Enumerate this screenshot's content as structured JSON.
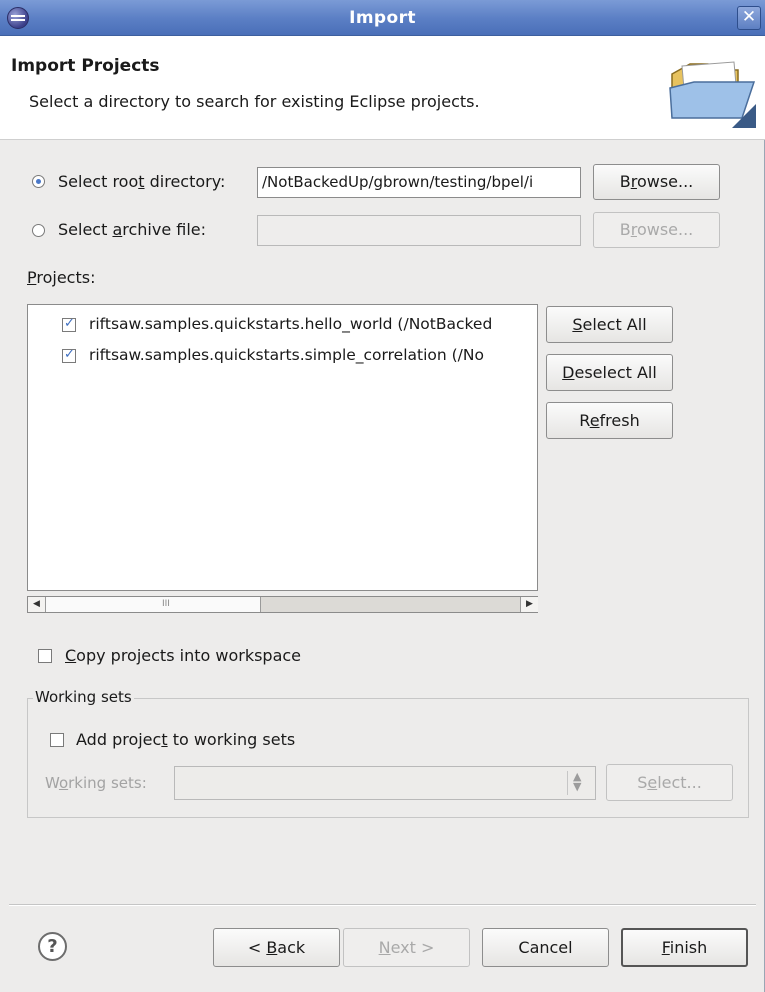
{
  "window": {
    "title": "Import"
  },
  "banner": {
    "title": "Import Projects",
    "description": "Select a directory to search for existing Eclipse projects."
  },
  "root_dir": {
    "label_pre": "Select roo",
    "label_key": "t",
    "label_post": " directory:",
    "value": "/NotBackedUp/gbrown/testing/bpel/i",
    "selected": true,
    "browse": {
      "pre": "B",
      "key": "r",
      "post": "owse..."
    }
  },
  "archive": {
    "label_pre": "Select ",
    "label_key": "a",
    "label_post": "rchive file:",
    "value": "",
    "browse": {
      "pre": "B",
      "key": "r",
      "post": "owse..."
    }
  },
  "projects": {
    "label_key": "P",
    "label_post": "rojects:",
    "items": [
      {
        "label": "riftsaw.samples.quickstarts.hello_world (/NotBacked",
        "checked": true
      },
      {
        "label": "riftsaw.samples.quickstarts.simple_correlation (/No",
        "checked": true
      }
    ],
    "scroll_grip": "III",
    "buttons": {
      "select_all": {
        "key": "S",
        "post": "elect All"
      },
      "deselect_all": {
        "key": "D",
        "post": "eselect All"
      },
      "refresh": {
        "pre": "R",
        "key": "e",
        "post": "fresh"
      }
    }
  },
  "copy_projects": {
    "key": "C",
    "post": "opy projects into workspace",
    "checked": false
  },
  "working_sets": {
    "group_title": "Working sets",
    "add": {
      "pre": "Add projec",
      "key": "t",
      "post": " to working sets",
      "checked": false
    },
    "field_label": {
      "pre": "W",
      "key": "o",
      "post": "rking sets:"
    },
    "select": {
      "pre": "S",
      "key": "e",
      "post": "lect..."
    }
  },
  "footer": {
    "help": "?",
    "back": {
      "pre": "< ",
      "key": "B",
      "post": "ack"
    },
    "next": {
      "key": "N",
      "post": "ext >"
    },
    "cancel": "Cancel",
    "finish": {
      "key": "F",
      "post": "inish"
    }
  }
}
